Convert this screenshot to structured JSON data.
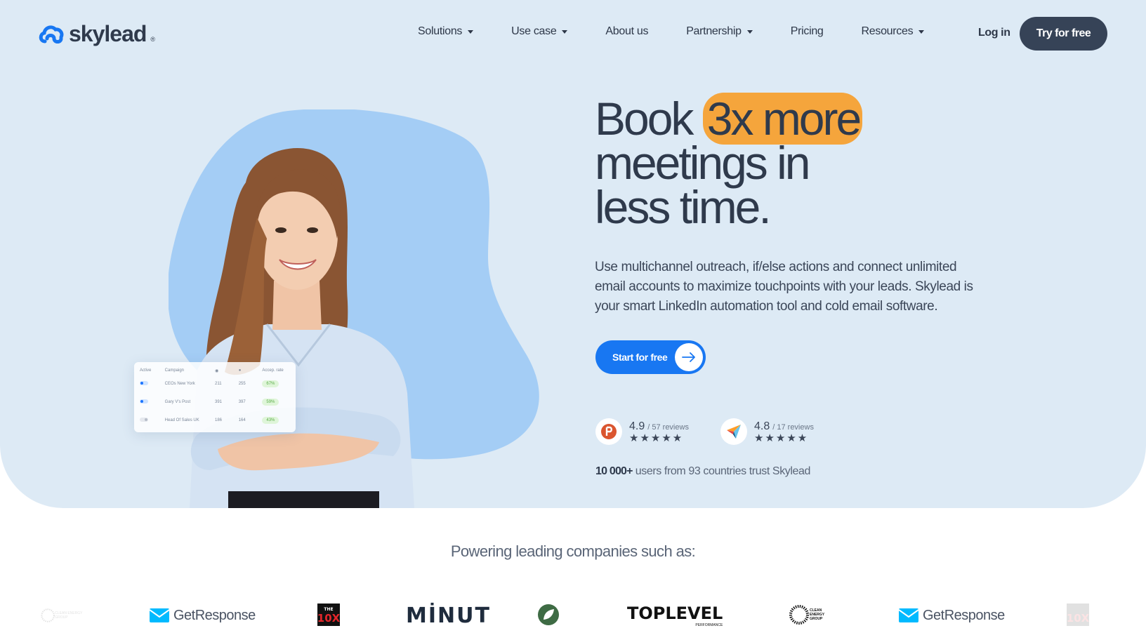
{
  "brand": {
    "name": "skylead",
    "reg": "®"
  },
  "nav": {
    "items": [
      {
        "label": "Solutions",
        "dropdown": true
      },
      {
        "label": "Use case",
        "dropdown": true
      },
      {
        "label": "About us",
        "dropdown": false
      },
      {
        "label": "Partnership",
        "dropdown": true
      },
      {
        "label": "Pricing",
        "dropdown": false
      },
      {
        "label": "Resources",
        "dropdown": true
      }
    ],
    "login": "Log in",
    "cta": "Try for free"
  },
  "hero": {
    "headline_part1": "Book ",
    "headline_highlight": "3x more",
    "headline_line2": "meetings in",
    "headline_line3": "less time.",
    "subtext": "Use multichannel outreach, if/else actions and connect unlimited email accounts to maximize touchpoints with your leads. Skylead is your smart LinkedIn automation tool and cold email software.",
    "cta": "Start for free",
    "ratings": [
      {
        "icon": "producthunt-icon",
        "score": "4.9",
        "count": "/ 57 reviews",
        "stars": "★★★★★"
      },
      {
        "icon": "capterra-icon",
        "score": "4.8",
        "count": "/ 17 reviews",
        "stars": "★★★★★"
      }
    ],
    "trust_bold": "10 000+",
    "trust_rest": " users from 93 countries trust Skylead"
  },
  "campaign_table": {
    "headers": [
      "Active",
      "Campaign",
      "",
      "",
      "Accep. rate"
    ],
    "rows": [
      {
        "active": true,
        "name": "CEOs New York",
        "views": "211",
        "replies": "255",
        "rate": "67%"
      },
      {
        "active": true,
        "name": "Gary V's Post",
        "views": "391",
        "replies": "397",
        "rate": "59%"
      },
      {
        "active": false,
        "name": "Head Of Sales UK",
        "views": "186",
        "replies": "164",
        "rate": "43%"
      }
    ]
  },
  "partners": {
    "title": "Powering leading companies such as:",
    "logos": {
      "getresponse": "GetResponse",
      "the10x": "THE 10X",
      "minut": "MİNUT",
      "toplevel": "TOPLEVEL",
      "toplevel_sub": "PERFORMANCE",
      "clean_energy": "CLEAN ENERGY GROUP"
    }
  },
  "colors": {
    "hero_bg": "#ddeaf5",
    "accent_blue": "#1877f2",
    "highlight": "#f5a53c",
    "dark": "#364357",
    "blob": "#a4cdf5"
  }
}
